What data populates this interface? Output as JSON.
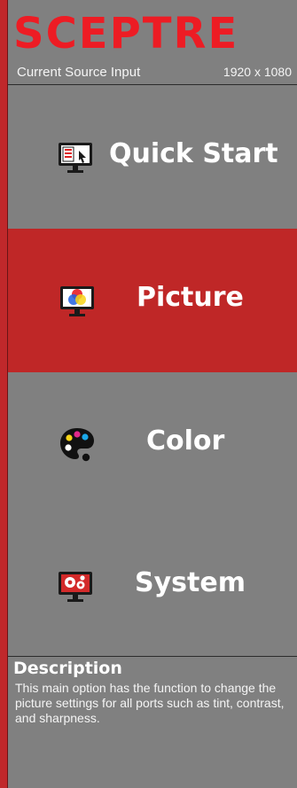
{
  "header": {
    "logo_text": "SCEPTRE",
    "source_label": "Current Source Input",
    "resolution": "1920 x 1080"
  },
  "menu": {
    "items": [
      {
        "label": "Quick Start",
        "icon": "monitor-cursor-icon",
        "selected": false
      },
      {
        "label": "Picture",
        "icon": "monitor-rgb-icon",
        "selected": true
      },
      {
        "label": "Color",
        "icon": "palette-icon",
        "selected": false
      },
      {
        "label": "System",
        "icon": "monitor-gears-icon",
        "selected": false
      }
    ]
  },
  "description": {
    "title": "Description",
    "text": "This main option has the function to change the picture settings for all ports such as tint, contrast, and sharpness."
  },
  "colors": {
    "brand_red": "#ed1c24",
    "selected_bg": "#bf2727",
    "panel_gray": "#808080"
  }
}
